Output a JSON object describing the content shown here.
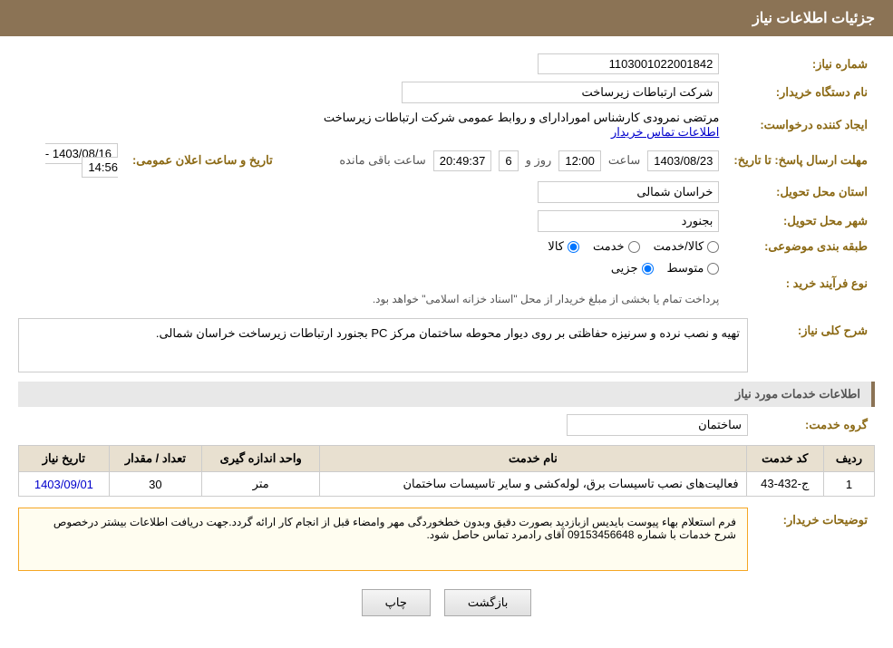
{
  "header": {
    "title": "جزئیات اطلاعات نیاز"
  },
  "fields": {
    "need_number_label": "شماره نیاز:",
    "need_number_value": "1103001022001842",
    "buyer_name_label": "نام دستگاه خریدار:",
    "buyer_name_value": "شرکت ارتباطات زیرساخت",
    "creator_label": "ایجاد کننده درخواست:",
    "creator_value": "مرتضی نمرودی کارشناس امورادارای و روابط عمومی شرکت ارتباطات زیرساخت",
    "contact_link": "اطلاعات تماس خریدار",
    "deadline_label": "مهلت ارسال پاسخ: تا تاریخ:",
    "deadline_date": "1403/08/23",
    "deadline_time_label": "ساعت",
    "deadline_time": "12:00",
    "deadline_days_label": "روز و",
    "deadline_days": "6",
    "deadline_remaining_label": "ساعت باقی مانده",
    "deadline_remaining": "20:49:37",
    "announce_label": "تاریخ و ساعت اعلان عمومی:",
    "announce_value": "1403/08/16 - 14:56",
    "province_label": "استان محل تحویل:",
    "province_value": "خراسان شمالی",
    "city_label": "شهر محل تحویل:",
    "city_value": "بجنورد",
    "category_label": "طبقه بندی موضوعی:",
    "category_options": [
      "کالا",
      "خدمت",
      "کالا/خدمت"
    ],
    "category_selected": "کالا",
    "process_label": "نوع فرآیند خرید :",
    "process_options": [
      "جزیی",
      "متوسط"
    ],
    "process_note": "پرداخت تمام یا بخشی از مبلغ خریدار از محل \"اسناد خزانه اسلامی\" خواهد بود.",
    "description_label": "شرح کلی نیاز:",
    "description_value": "تهیه و نصب نرده و سرنیزه حفاظتی بر روی دیوار محوطه ساختمان مرکز PC بجنورد  ارتباطات زیرساخت خراسان شمالی.",
    "services_section": "اطلاعات خدمات مورد نیاز",
    "service_group_label": "گروه خدمت:",
    "service_group_value": "ساختمان",
    "table": {
      "headers": [
        "ردیف",
        "کد خدمت",
        "نام خدمت",
        "واحد اندازه گیری",
        "تعداد / مقدار",
        "تاریخ نیاز"
      ],
      "rows": [
        {
          "row_num": "1",
          "service_code": "ج-432-43",
          "service_name": "فعالیت‌های نصب تاسیسات برق، لوله‌کشی و سایر تاسیسات ساختمان",
          "unit": "متر",
          "quantity": "30",
          "date": "1403/09/01"
        }
      ]
    },
    "buyer_notes_label": "توضیحات خریدار:",
    "buyer_notes_value": "فرم استعلام بهاء پیوست بایدیس ازبازدید بصورت دقیق وبدون خطخوردگی  مهر وامضاء قبل از انجام کار ارائه گردد.جهت دریافت اطلاعات بیشتر درخصوص شرح خدمات با شماره 09153456648 آقای رادمرد تماس حاصل شود."
  },
  "buttons": {
    "print": "چاپ",
    "back": "بازگشت"
  }
}
